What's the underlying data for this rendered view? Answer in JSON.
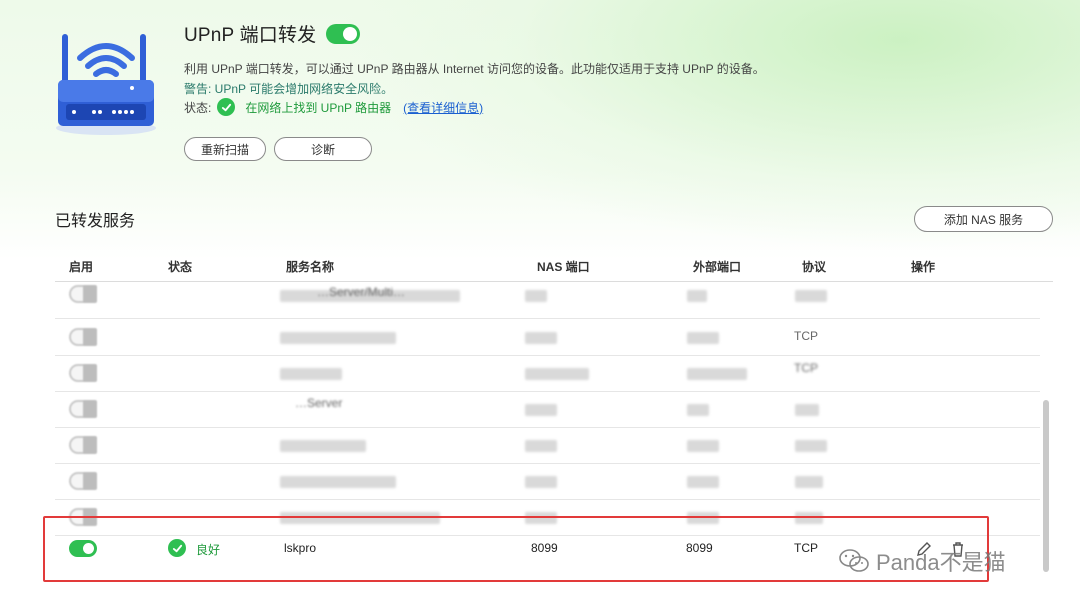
{
  "header": {
    "title": "UPnP 端口转发",
    "description": "利用 UPnP 端口转发，可以通过 UPnP 路由器从 Internet 访问您的设备。此功能仅适用于支持 UPnP 的设备。",
    "warning": "警告: UPnP 可能会增加网络安全风险。",
    "status_label": "状态:",
    "status_text": "在网络上找到 UPnP 路由器",
    "status_link": "(查看详细信息)",
    "toggle_enabled": true
  },
  "buttons": {
    "rescan": "重新扫描",
    "diagnose": "诊断",
    "add_nas_service": "添加 NAS 服务"
  },
  "section": {
    "title": "已转发服务"
  },
  "table": {
    "columns": [
      "启用",
      "状态",
      "服务名称",
      "NAS 端口",
      "外部端口",
      "协议",
      "操作"
    ],
    "blurred_rows_visible_fragments": [
      {
        "service": "…Server/Multi…",
        "protocol": ""
      },
      {
        "service": "",
        "protocol": "TCP"
      },
      {
        "service": "",
        "protocol": "TCP"
      },
      {
        "service": "…Server",
        "protocol": ""
      },
      {
        "service": "",
        "protocol": ""
      },
      {
        "service": "",
        "protocol": ""
      },
      {
        "service": "",
        "protocol": ""
      }
    ],
    "highlighted_row": {
      "enabled": true,
      "status": "良好",
      "service_name": "lskpro",
      "nas_port": "8099",
      "external_port": "8099",
      "protocol": "TCP"
    }
  },
  "watermark": {
    "text": "Panda不是猫"
  },
  "colors": {
    "accent_green": "#2fbf52",
    "link_blue": "#1a5fd0",
    "highlight_red": "#e23a3a",
    "router_blue": "#2f5fd6"
  }
}
